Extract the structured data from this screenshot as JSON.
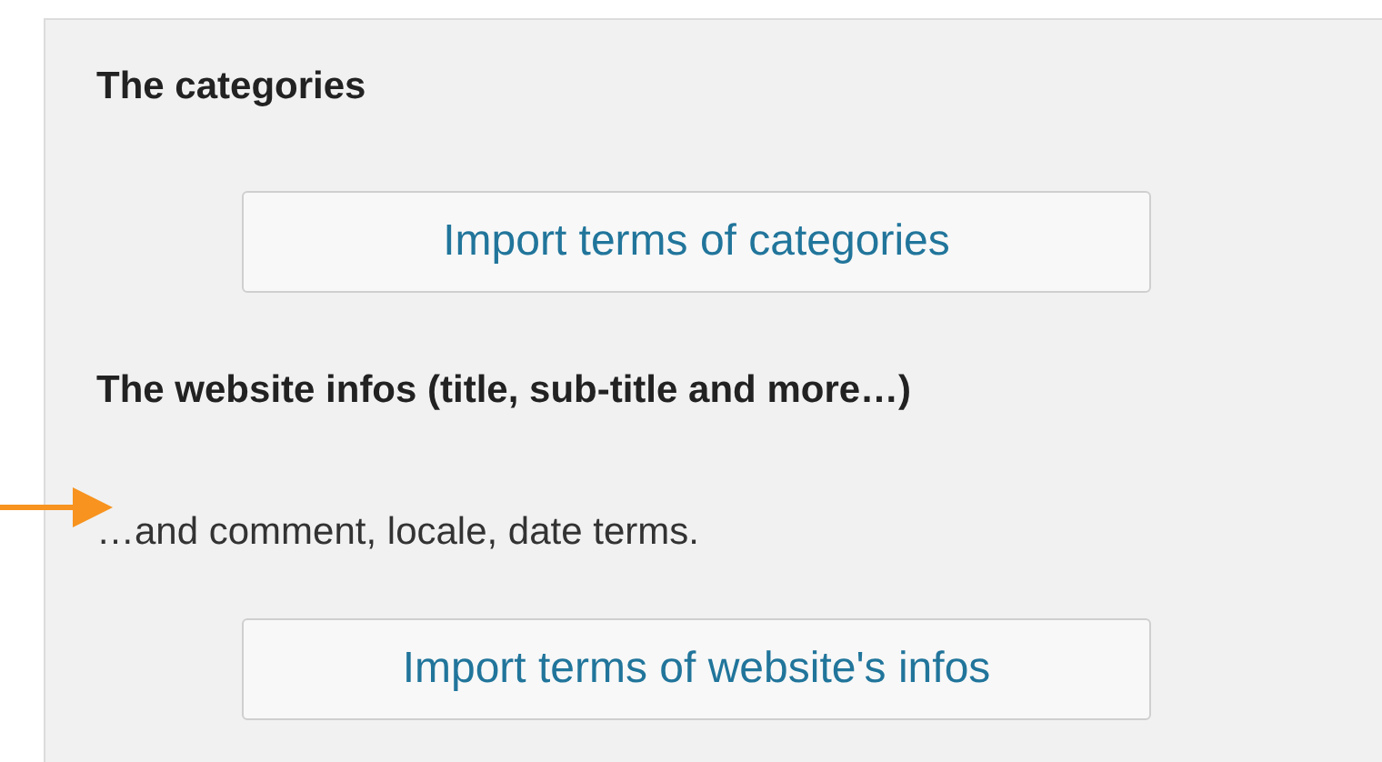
{
  "sections": [
    {
      "heading": "The categories",
      "button": "Import terms of categories"
    },
    {
      "heading": "The website infos (title, sub-title and more…)",
      "note": "…and comment, locale, date terms.",
      "button": "Import terms of website's infos"
    }
  ]
}
